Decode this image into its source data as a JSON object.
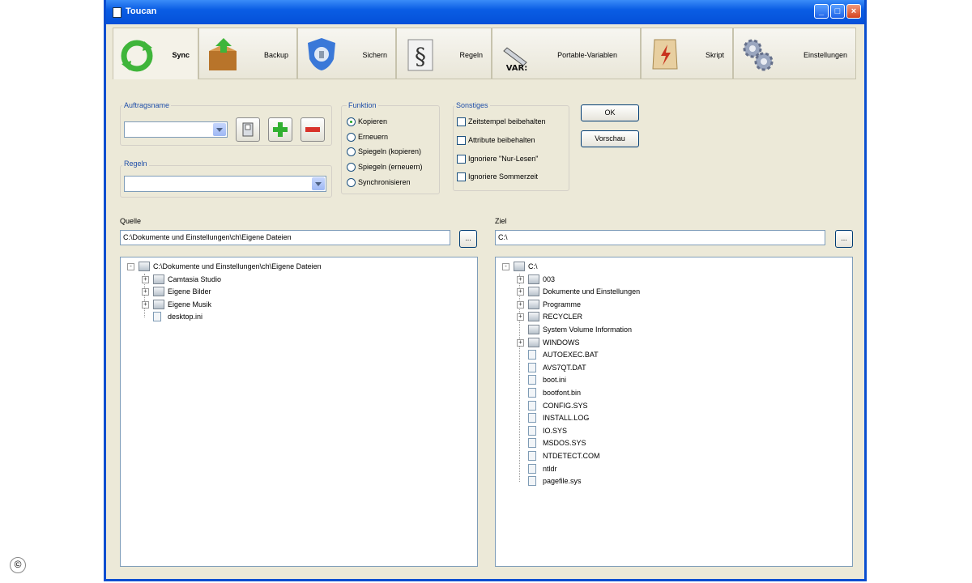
{
  "window": {
    "title": "Toucan"
  },
  "tabs": [
    {
      "label": "Sync",
      "icon": "sync-icon",
      "active": true
    },
    {
      "label": "Backup",
      "icon": "backup-box-icon"
    },
    {
      "label": "Sichern",
      "icon": "secure-shield-icon"
    },
    {
      "label": "Regeln",
      "icon": "rules-paragraph-icon"
    },
    {
      "label": "Portable-Variablen",
      "icon": "variables-icon",
      "icon_text": "VAR:"
    },
    {
      "label": "Skript",
      "icon": "script-icon"
    },
    {
      "label": "Einstellungen",
      "icon": "settings-gears-icon"
    }
  ],
  "job": {
    "label": "Auftragsname",
    "value": ""
  },
  "rules": {
    "label": "Regeln",
    "value": ""
  },
  "function": {
    "label": "Funktion",
    "options": [
      "Kopieren",
      "Erneuern",
      "Spiegeln (kopieren)",
      "Spiegeln (erneuern)",
      "Synchronisieren"
    ],
    "selected": 0
  },
  "other": {
    "label": "Sonstiges",
    "options": [
      "Zeitstempel beibehalten",
      "Attribute beibehalten",
      "Ignoriere \"Nur-Lesen\"",
      "Ignoriere Sommerzeit"
    ]
  },
  "buttons": {
    "ok": "OK",
    "preview": "Vorschau",
    "browse": "..."
  },
  "source": {
    "label": "Quelle",
    "path": "C:\\Dokumente und Einstellungen\\ch\\Eigene Dateien",
    "tree": [
      {
        "text": "C:\\Dokumente und Einstellungen\\ch\\Eigene Dateien",
        "level": 0,
        "kind": "folder",
        "exp": "-"
      },
      {
        "text": "Camtasia Studio",
        "level": 1,
        "kind": "folder",
        "exp": "+"
      },
      {
        "text": "Eigene Bilder",
        "level": 1,
        "kind": "folder",
        "exp": "+"
      },
      {
        "text": "Eigene Musik",
        "level": 1,
        "kind": "folder",
        "exp": "+"
      },
      {
        "text": "desktop.ini",
        "level": 1,
        "kind": "file",
        "exp": ""
      }
    ]
  },
  "target": {
    "label": "Ziel",
    "path": "C:\\",
    "tree": [
      {
        "text": "C:\\",
        "level": 0,
        "kind": "folder",
        "exp": "-"
      },
      {
        "text": "003",
        "level": 1,
        "kind": "folder",
        "exp": "+"
      },
      {
        "text": "Dokumente und Einstellungen",
        "level": 1,
        "kind": "folder",
        "exp": "+"
      },
      {
        "text": "Programme",
        "level": 1,
        "kind": "folder",
        "exp": "+"
      },
      {
        "text": "RECYCLER",
        "level": 1,
        "kind": "folder",
        "exp": "+"
      },
      {
        "text": "System Volume Information",
        "level": 1,
        "kind": "folder",
        "exp": ""
      },
      {
        "text": "WINDOWS",
        "level": 1,
        "kind": "folder",
        "exp": "+"
      },
      {
        "text": "AUTOEXEC.BAT",
        "level": 1,
        "kind": "file",
        "exp": ""
      },
      {
        "text": "AVS7QT.DAT",
        "level": 1,
        "kind": "file",
        "exp": ""
      },
      {
        "text": "boot.ini",
        "level": 1,
        "kind": "file",
        "exp": ""
      },
      {
        "text": "bootfont.bin",
        "level": 1,
        "kind": "file",
        "exp": ""
      },
      {
        "text": "CONFIG.SYS",
        "level": 1,
        "kind": "file",
        "exp": ""
      },
      {
        "text": "INSTALL.LOG",
        "level": 1,
        "kind": "file",
        "exp": ""
      },
      {
        "text": "IO.SYS",
        "level": 1,
        "kind": "file",
        "exp": ""
      },
      {
        "text": "MSDOS.SYS",
        "level": 1,
        "kind": "file",
        "exp": ""
      },
      {
        "text": "NTDETECT.COM",
        "level": 1,
        "kind": "file",
        "exp": ""
      },
      {
        "text": "ntldr",
        "level": 1,
        "kind": "file",
        "exp": ""
      },
      {
        "text": "pagefile.sys",
        "level": 1,
        "kind": "file",
        "exp": ""
      }
    ]
  },
  "copyright": "©"
}
